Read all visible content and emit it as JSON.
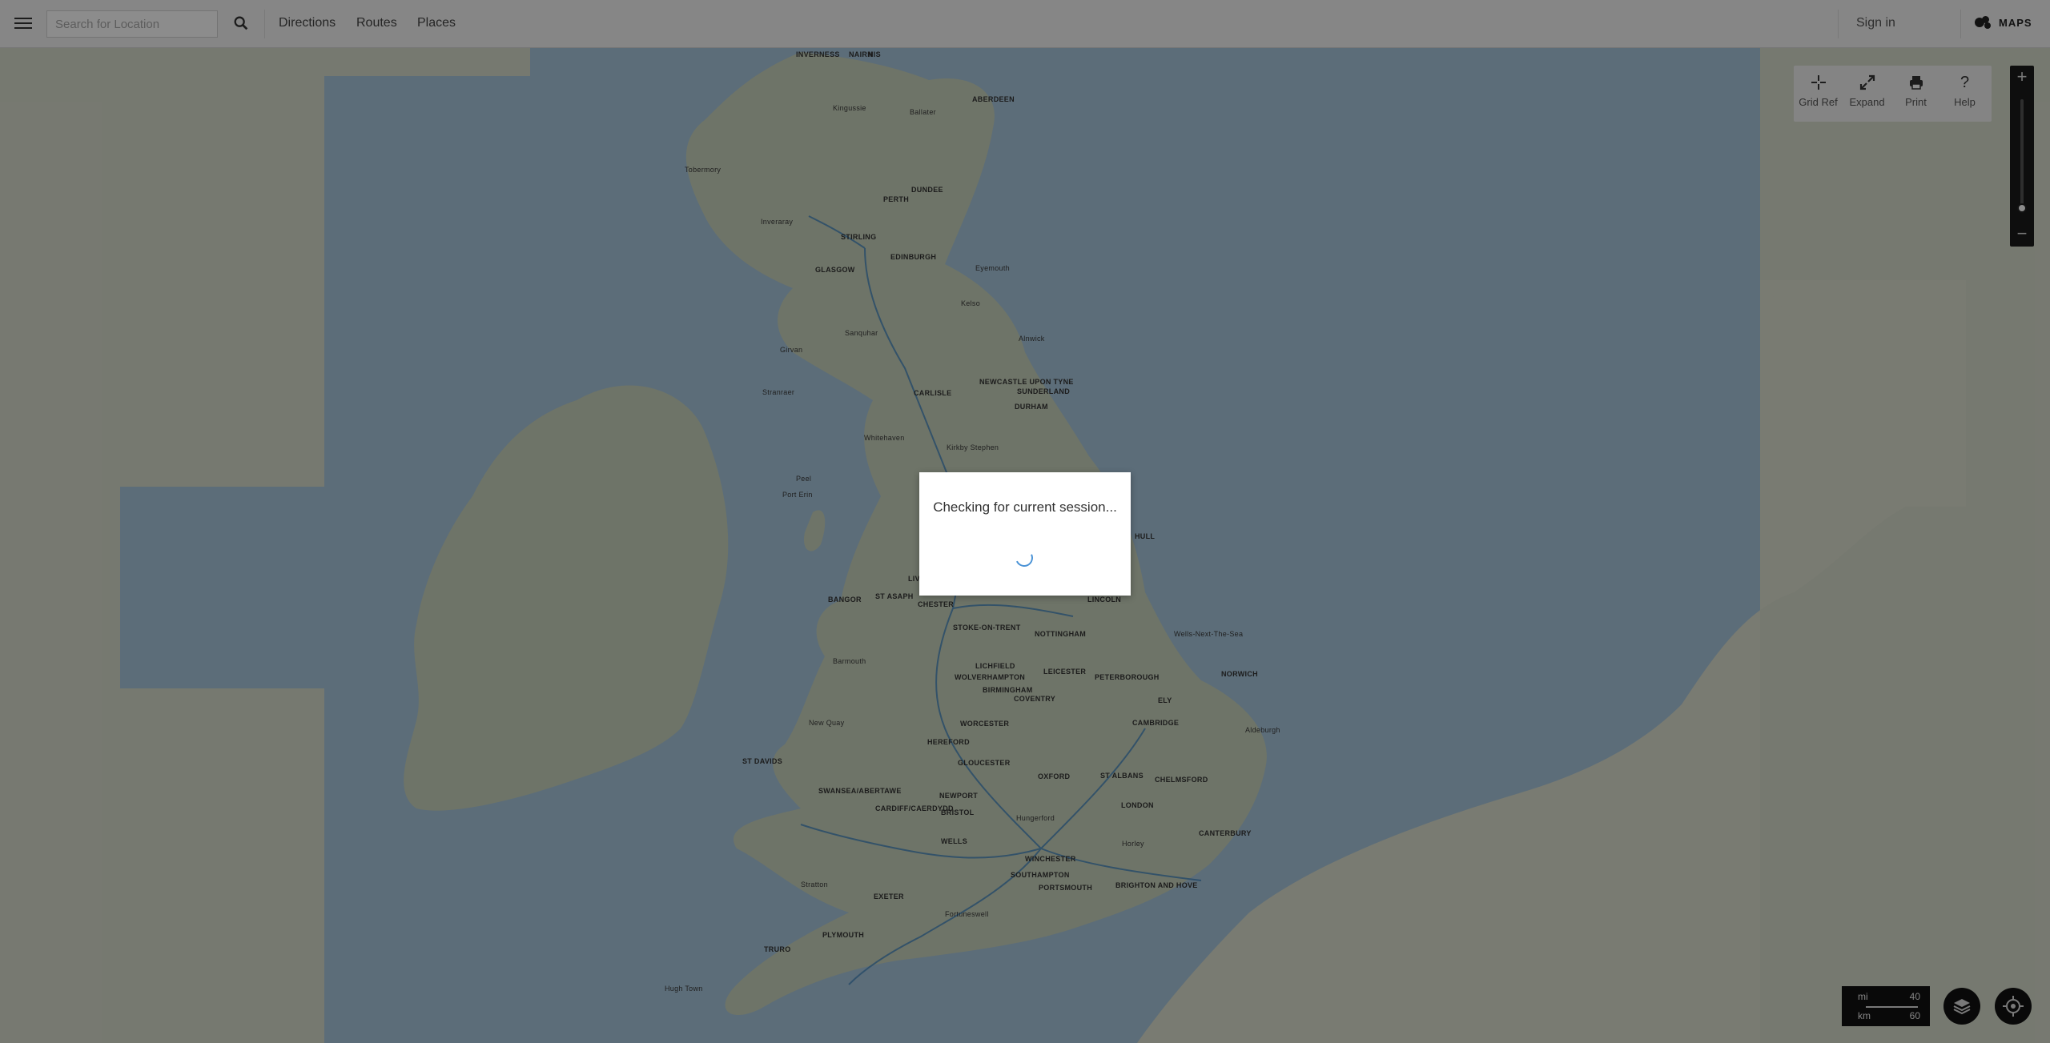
{
  "header": {
    "search_placeholder": "Search for Location",
    "nav": [
      "Directions",
      "Routes",
      "Places"
    ],
    "sign_in": "Sign in",
    "brand": "MAPS"
  },
  "tools": [
    {
      "label": "Grid Ref",
      "icon": "crosshair-icon"
    },
    {
      "label": "Expand",
      "icon": "expand-icon"
    },
    {
      "label": "Print",
      "icon": "print-icon"
    },
    {
      "label": "Help",
      "icon": "help-icon"
    }
  ],
  "zoom": {
    "in": "+",
    "out": "−",
    "level": 0.1
  },
  "scale": {
    "mi_label": "mi",
    "mi_value": "40",
    "km_label": "km",
    "km_value": "60"
  },
  "modal": {
    "message": "Checking for current session..."
  },
  "places": [
    "INVERNESS",
    "NAIRN",
    "NIS",
    "Kingussie",
    "Ballater",
    "ABERDEEN",
    "Tobermory",
    "PERTH",
    "DUNDEE",
    "Inveraray",
    "STIRLING",
    "GLASGOW",
    "EDINBURGH",
    "Eyemouth",
    "Kelso",
    "Sanquhar",
    "Girvan",
    "Alnwick",
    "Stranraer",
    "CARLISLE",
    "NEWCASTLE UPON TYNE",
    "SUNDERLAND",
    "DURHAM",
    "Whitehaven",
    "Kirkby Stephen",
    "Peel",
    "Port Erin",
    "HULL",
    "BANGOR",
    "ST ASAPH",
    "CHESTER",
    "LINCOLN",
    "STOKE-ON-TRENT",
    "NOTTINGHAM",
    "Wells-Next-The-Sea",
    "Barmouth",
    "LICHFIELD",
    "LEICESTER",
    "PETERBOROUGH",
    "NORWICH",
    "WOLVERHAMPTON",
    "BIRMINGHAM",
    "COVENTRY",
    "ELY",
    "New Quay",
    "WORCESTER",
    "CAMBRIDGE",
    "Aldeburgh",
    "HEREFORD",
    "ST DAVIDS",
    "GLOUCESTER",
    "OXFORD",
    "ST ALBANS",
    "CHELMSFORD",
    "SWANSEA/ABERTAWE",
    "NEWPORT",
    "CARDIFF/CAERDYDD",
    "BRISTOL",
    "LONDON",
    "Hungerford",
    "CANTERBURY",
    "WELLS",
    "Horley",
    "WINCHESTER",
    "SOUTHAMPTON",
    "PORTSMOUTH",
    "Stratton",
    "EXETER",
    "BRIGHTON AND HOVE",
    "PLYMOUTH",
    "Fortuneswell",
    "TRURO",
    "Hugh Town",
    "LIVERPOOL"
  ]
}
